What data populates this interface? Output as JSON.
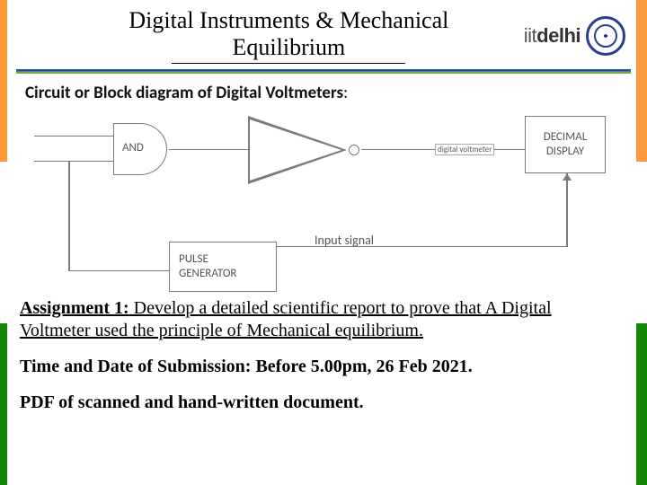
{
  "header": {
    "title_line1": "Digital Instruments & Mechanical",
    "title_line2": "Equilibrium",
    "brand_prefix": "iit",
    "brand_suffix": "delhi"
  },
  "section": {
    "heading_bold": "Circuit or Block diagram of Digital Voltmeters",
    "heading_suffix": ":"
  },
  "diagram": {
    "and_label": "AND",
    "pulse_line1": "PULSE",
    "pulse_line2": "GENERATOR",
    "input_signal": "Input signal",
    "tiny_label": "digital voltmeter",
    "display_line1": "DECIMAL",
    "display_line2": "DISPLAY"
  },
  "body": {
    "assign_label": "Assignment 1:",
    "assign_text": " Develop a detailed scientific report to prove that A Digital Voltmeter used the principle of Mechanical equilibrium.",
    "time_label": "Time and Date of Submission: Before 5.00pm, 26 Feb 2021.",
    "pdf": "PDF of scanned and hand-written document."
  }
}
